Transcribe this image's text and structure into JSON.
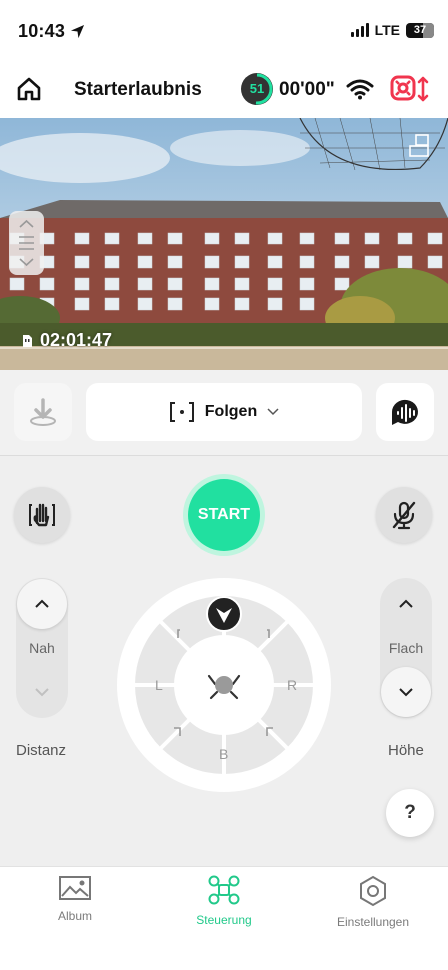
{
  "status_bar": {
    "time": "10:43",
    "network": "LTE",
    "battery": "37"
  },
  "header": {
    "title": "Starterlaubnis",
    "battery_ring_value": "51",
    "flight_timer": "00'00\""
  },
  "camera": {
    "recording_time": "02:01:47"
  },
  "mode": {
    "selected": "Folgen"
  },
  "controls": {
    "start_label": "START",
    "distance_value": "Nah",
    "distance_caption": "Distanz",
    "height_value": "Flach",
    "height_caption": "Höhe",
    "dial_left": "L",
    "dial_right": "R",
    "dial_bottom": "B",
    "help_label": "?"
  },
  "tabs": [
    {
      "label": "Album",
      "icon": "image-icon"
    },
    {
      "label": "Steuerung",
      "icon": "drone-icon",
      "active": true
    },
    {
      "label": "Einstellungen",
      "icon": "hexagon-settings-icon"
    }
  ],
  "colors": {
    "accent": "#21e0a0",
    "alert": "#f0354e"
  }
}
